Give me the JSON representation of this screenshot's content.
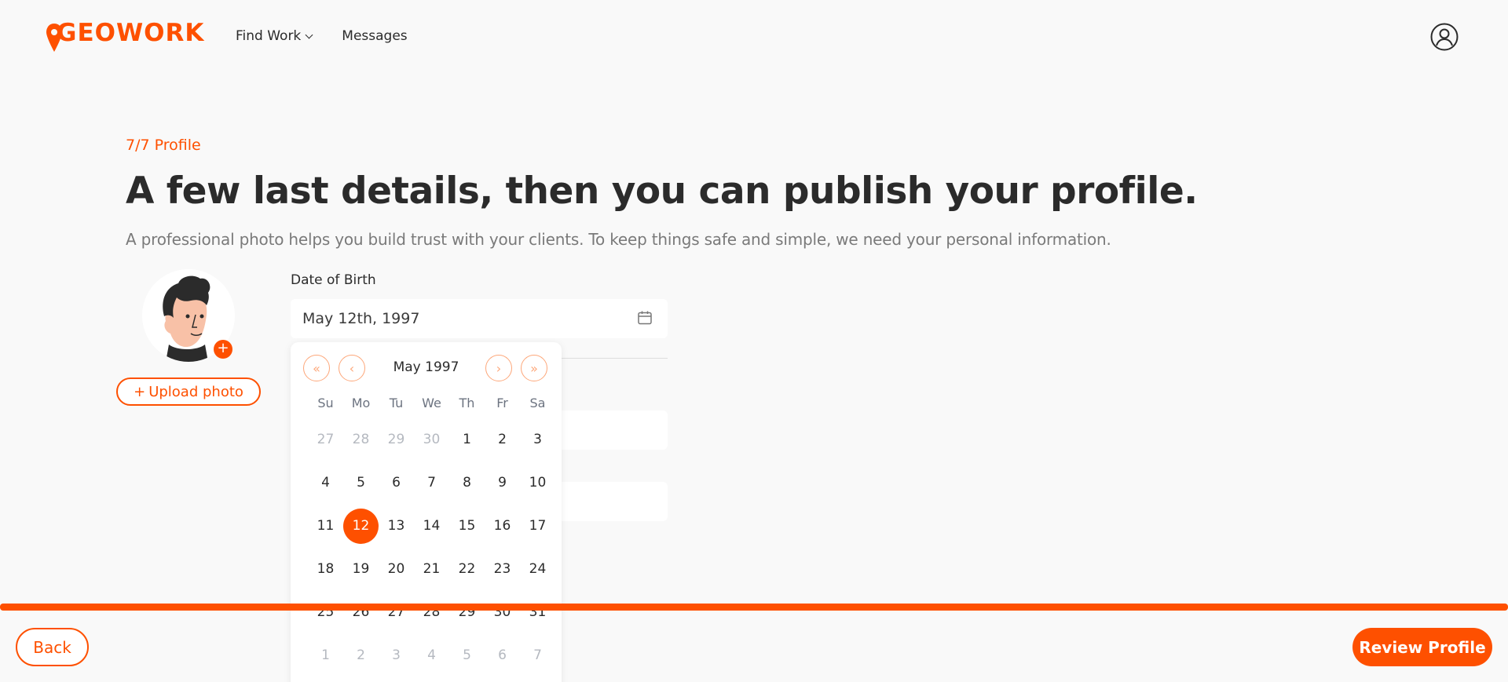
{
  "brand": {
    "name": "GEOWORK",
    "accent": "#fe5000"
  },
  "nav": {
    "find_work": "Find Work",
    "messages": "Messages"
  },
  "header": {
    "user_icon": "user-circle-icon"
  },
  "main": {
    "step": "7/7 Profile",
    "title": "A few last details, then you can publish your profile.",
    "subtitle": "A professional photo helps you build trust with your clients. To keep things safe and simple, we need your personal information.",
    "upload_label": "Upload photo",
    "upload_icon": "plus-icon"
  },
  "dob": {
    "label": "Date of Birth",
    "value": "May 12th, 1997",
    "icon": "calendar-icon"
  },
  "calendar": {
    "title": "May 1997",
    "nav": {
      "prev_year": "«",
      "prev_month": "‹",
      "next_month": "›",
      "next_year": "»"
    },
    "weekdays": [
      "Su",
      "Mo",
      "Tu",
      "We",
      "Th",
      "Fr",
      "Sa"
    ],
    "weeks": [
      [
        "27",
        "28",
        "29",
        "30",
        "1",
        "2",
        "3"
      ],
      [
        "4",
        "5",
        "6",
        "7",
        "8",
        "9",
        "10"
      ],
      [
        "11",
        "12",
        "13",
        "14",
        "15",
        "16",
        "17"
      ],
      [
        "18",
        "19",
        "20",
        "21",
        "22",
        "23",
        "24"
      ],
      [
        "25",
        "26",
        "27",
        "28",
        "29",
        "30",
        "31"
      ],
      [
        "1",
        "2",
        "3",
        "4",
        "5",
        "6",
        "7"
      ]
    ],
    "muted": [
      [
        0,
        0
      ],
      [
        0,
        1
      ],
      [
        0,
        2
      ],
      [
        0,
        3
      ],
      [
        5,
        0
      ],
      [
        5,
        1
      ],
      [
        5,
        2
      ],
      [
        5,
        3
      ],
      [
        5,
        4
      ],
      [
        5,
        5
      ],
      [
        5,
        6
      ]
    ],
    "selected": [
      2,
      1
    ]
  },
  "footer": {
    "back": "Back",
    "review": "Review Profile",
    "progress": 1.0
  }
}
